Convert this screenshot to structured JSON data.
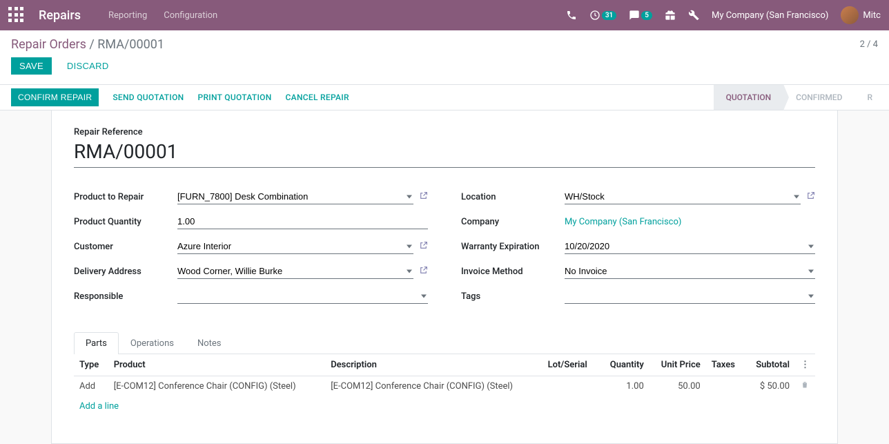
{
  "navbar": {
    "brand": "Repairs",
    "menu": {
      "reporting": "Reporting",
      "configuration": "Configuration"
    },
    "activities_count": "31",
    "messages_count": "5",
    "company": "My Company (San Francisco)",
    "user": "Mitc"
  },
  "breadcrumb": {
    "root": "Repair Orders",
    "sep": " / ",
    "current": "RMA/00001"
  },
  "pager": "2 / 4",
  "buttons": {
    "save": "Save",
    "discard": "Discard"
  },
  "actions": {
    "confirm": "Confirm Repair",
    "send_quotation": "Send Quotation",
    "print_quotation": "Print Quotation",
    "cancel_repair": "Cancel Repair"
  },
  "status": {
    "quotation": "Quotation",
    "confirmed": "Confirmed",
    "next": "R"
  },
  "form": {
    "ref_label": "Repair Reference",
    "ref_value": "RMA/00001",
    "left": {
      "product_to_repair": {
        "label": "Product to Repair",
        "value": "[FURN_7800] Desk Combination"
      },
      "product_qty": {
        "label": "Product Quantity",
        "value": "1.00"
      },
      "customer": {
        "label": "Customer",
        "value": "Azure Interior"
      },
      "delivery_address": {
        "label": "Delivery Address",
        "value": "Wood Corner, Willie Burke"
      },
      "responsible": {
        "label": "Responsible",
        "value": ""
      }
    },
    "right": {
      "location": {
        "label": "Location",
        "value": "WH/Stock"
      },
      "company": {
        "label": "Company",
        "value": "My Company (San Francisco)"
      },
      "warranty": {
        "label": "Warranty Expiration",
        "value": "10/20/2020"
      },
      "invoice_method": {
        "label": "Invoice Method",
        "value": "No Invoice"
      },
      "tags": {
        "label": "Tags",
        "value": ""
      }
    }
  },
  "tabs": {
    "parts": "Parts",
    "operations": "Operations",
    "notes": "Notes"
  },
  "table": {
    "headers": {
      "type": "Type",
      "product": "Product",
      "description": "Description",
      "lot": "Lot/Serial",
      "qty": "Quantity",
      "unit_price": "Unit Price",
      "taxes": "Taxes",
      "subtotal": "Subtotal"
    },
    "rows": [
      {
        "type": "Add",
        "product": "[E-COM12] Conference Chair (CONFIG) (Steel)",
        "description": "[E-COM12] Conference Chair (CONFIG) (Steel)",
        "lot": "",
        "qty": "1.00",
        "unit_price": "50.00",
        "taxes": "",
        "subtotal": "$ 50.00"
      }
    ],
    "add_line": "Add a line"
  }
}
